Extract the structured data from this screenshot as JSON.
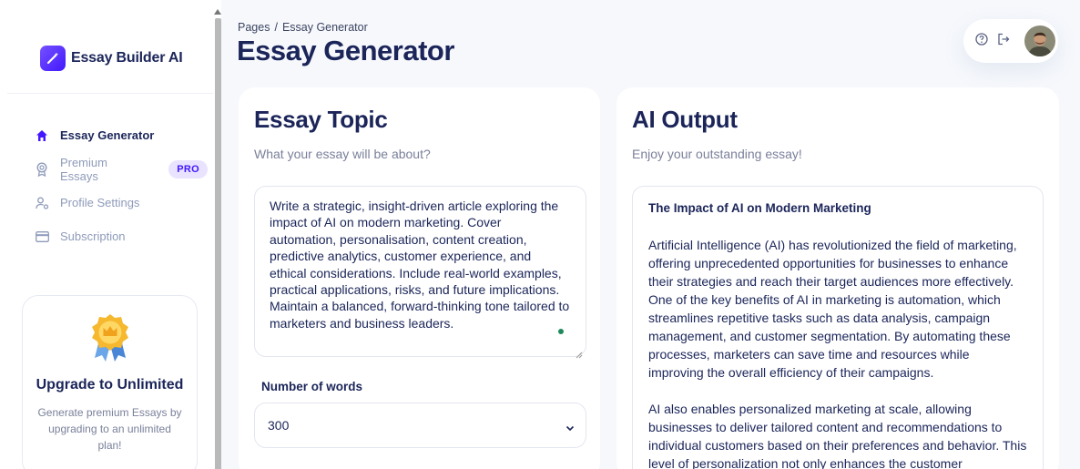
{
  "brand": {
    "name": "Essay Builder AI"
  },
  "sidebar": {
    "items": [
      {
        "label": "Essay Generator",
        "icon": "home-icon",
        "active": true
      },
      {
        "label": "Premium Essays",
        "icon": "award-icon",
        "badge": "PRO"
      },
      {
        "label": "Profile Settings",
        "icon": "user-settings-icon"
      },
      {
        "label": "Subscription",
        "icon": "credit-card-icon"
      }
    ]
  },
  "upgrade": {
    "title": "Upgrade to Unlimited",
    "description": "Generate premium Essays by upgrading to an unlimited plan!"
  },
  "header": {
    "breadcrumb_root": "Pages",
    "breadcrumb_sep": "/",
    "breadcrumb_current": "Essay Generator",
    "title": "Essay Generator"
  },
  "topic_card": {
    "title": "Essay Topic",
    "subtitle": "What your essay will be about?",
    "topic_value": "Write a strategic, insight-driven article exploring the impact of AI on modern marketing. Cover automation, personalisation, content creation, predictive analytics, customer experience, and ethical considerations. Include real-world examples, practical applications, risks, and future implications. Maintain a balanced, forward-thinking tone tailored to marketers and business leaders.",
    "words_label": "Number of words",
    "words_value": "300"
  },
  "output_card": {
    "title": "AI Output",
    "subtitle": "Enjoy your outstanding essay!",
    "essay_title": "The Impact of AI on Modern Marketing",
    "paragraphs": [
      "Artificial Intelligence (AI) has revolutionized the field of marketing, offering unprecedented opportunities for businesses to enhance their strategies and reach their target audiences more effectively. One of the key benefits of AI in marketing is automation, which streamlines repetitive tasks such as data analysis, campaign management, and customer segmentation. By automating these processes, marketers can save time and resources while improving the overall efficiency of their campaigns.",
      "AI also enables personalized marketing at scale, allowing businesses to deliver tailored content and recommendations to individual customers based on their preferences and behavior. This level of personalization not only enhances the customer"
    ]
  },
  "colors": {
    "brand_primary": "#4318ff",
    "text_dark": "#1b2559",
    "text_muted": "#8f9bba",
    "badge_bg": "#e9e3ff",
    "main_bg": "#f6f8fc"
  }
}
